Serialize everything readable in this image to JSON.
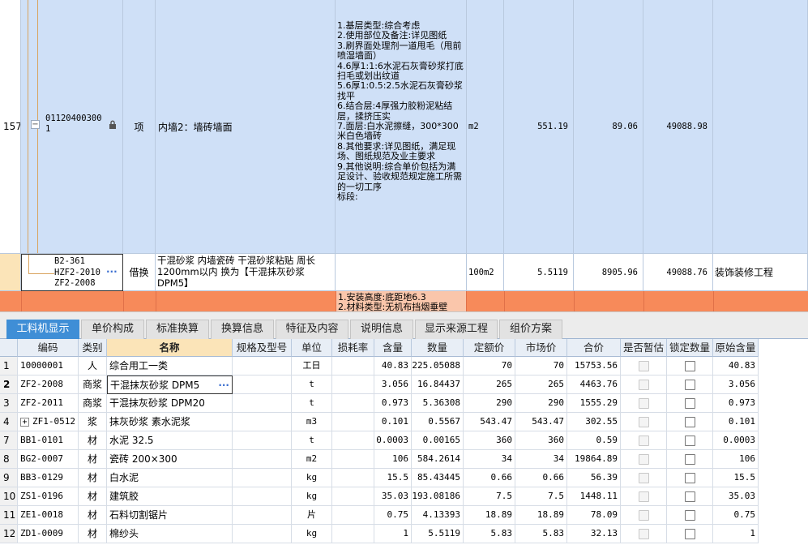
{
  "item157": {
    "row_no": "157",
    "code": "011204003001",
    "type": "项",
    "name": "内墙2：墙砖墙面",
    "features": "1.基层类型:综合考虑\n2.使用部位及备注:详见图纸\n3.刷界面处理剂一道甩毛（甩前喷湿墙面）\n4.6厚1:1:6水泥石灰膏砂浆打底扫毛或划出纹道\n5.6厚1:0.5:2.5水泥石灰膏砂浆找平\n6.结合层:4厚强力胶粉泥粘结层，揉挤压实\n7.面层:白水泥擦缝，300*300米白色墙砖\n8.其他要求:详见图纸，满足现场、图纸规范及业主要求\n9.其他说明:综合单价包括为满足设计、验收规范规定施工所需的一切工序\n标段:",
    "unit": "m2",
    "quantity": "551.19",
    "unit_price": "89.06",
    "total": "49088.98"
  },
  "sub_item": {
    "code": "B2-361\nHZF2-2010\nZF2-2008",
    "type": "借换",
    "name": "干混砂浆 内墙瓷砖 干混砂浆粘贴 周长1200mm以内  换为【干混抹灰砂浆 DPM5】",
    "unit": "100m2",
    "quantity": "5.5119",
    "unit_price": "8905.96",
    "total": "49088.76",
    "specialty": "装饰装修工程",
    "more_btn": "···"
  },
  "next_row": {
    "features": "1.安装高度:底距地6.3\n2.材料类型:无机布挡烟垂壁"
  },
  "tabs": [
    "工料机显示",
    "单价构成",
    "标准换算",
    "换算信息",
    "特征及内容",
    "说明信息",
    "显示来源工程",
    "组价方案"
  ],
  "table": {
    "headers": [
      "编码",
      "类别",
      "名称",
      "规格及型号",
      "单位",
      "损耗率",
      "含量",
      "数量",
      "定额价",
      "市场价",
      "合价",
      "是否暂估",
      "锁定数量",
      "原始含量"
    ],
    "rows": [
      {
        "no": "1",
        "code": "10000001",
        "cat": "人",
        "name": "综合用工一类",
        "spec": "",
        "unit": "工日",
        "loss": "",
        "content": "40.83",
        "qty": "225.05088",
        "quota": "70",
        "market": "70",
        "total": "15753.56",
        "orig": "40.83"
      },
      {
        "no": "2",
        "code": "ZF2-2008",
        "cat": "商浆",
        "name": "干混抹灰砂浆 DPM5",
        "spec": "",
        "unit": "t",
        "loss": "",
        "content": "3.056",
        "qty": "16.84437",
        "quota": "265",
        "market": "265",
        "total": "4463.76",
        "orig": "3.056"
      },
      {
        "no": "3",
        "code": "ZF2-2011",
        "cat": "商浆",
        "name": "干混抹灰砂浆 DPM20",
        "spec": "",
        "unit": "t",
        "loss": "",
        "content": "0.973",
        "qty": "5.36308",
        "quota": "290",
        "market": "290",
        "total": "1555.29",
        "orig": "0.973"
      },
      {
        "no": "4",
        "code": "ZF1-0512",
        "cat": "浆",
        "name": "抹灰砂浆 素水泥浆",
        "spec": "",
        "unit": "m3",
        "loss": "",
        "content": "0.101",
        "qty": "0.5567",
        "quota": "543.47",
        "market": "543.47",
        "total": "302.55",
        "orig": "0.101"
      },
      {
        "no": "7",
        "code": "BB1-0101",
        "cat": "材",
        "name": "水泥 32.5",
        "spec": "",
        "unit": "t",
        "loss": "",
        "content": "0.0003",
        "qty": "0.00165",
        "quota": "360",
        "market": "360",
        "total": "0.59",
        "orig": "0.0003"
      },
      {
        "no": "8",
        "code": "BG2-0007",
        "cat": "材",
        "name": "瓷砖 200×300",
        "spec": "",
        "unit": "m2",
        "loss": "",
        "content": "106",
        "qty": "584.2614",
        "quota": "34",
        "market": "34",
        "total": "19864.89",
        "orig": "106"
      },
      {
        "no": "9",
        "code": "BB3-0129",
        "cat": "材",
        "name": "白水泥",
        "spec": "",
        "unit": "kg",
        "loss": "",
        "content": "15.5",
        "qty": "85.43445",
        "quota": "0.66",
        "market": "0.66",
        "total": "56.39",
        "orig": "15.5"
      },
      {
        "no": "10",
        "code": "ZS1-0196",
        "cat": "材",
        "name": "建筑胶",
        "spec": "",
        "unit": "kg",
        "loss": "",
        "content": "35.03",
        "qty": "193.08186",
        "quota": "7.5",
        "market": "7.5",
        "total": "1448.11",
        "orig": "35.03"
      },
      {
        "no": "11",
        "code": "ZE1-0018",
        "cat": "材",
        "name": "石料切割锯片",
        "spec": "",
        "unit": "片",
        "loss": "",
        "content": "0.75",
        "qty": "4.13393",
        "quota": "18.89",
        "market": "18.89",
        "total": "78.09",
        "orig": "0.75"
      },
      {
        "no": "12",
        "code": "ZD1-0009",
        "cat": "材",
        "name": "棉纱头",
        "spec": "",
        "unit": "kg",
        "loss": "",
        "content": "1",
        "qty": "5.5119",
        "quota": "5.83",
        "market": "5.83",
        "total": "32.13",
        "orig": "1"
      }
    ]
  },
  "colors": {
    "row_blue": "#cfe0f7",
    "row_orange": "#f78a5a",
    "tab_active": "#3f8ed6",
    "name_header": "#fbe4b8"
  }
}
